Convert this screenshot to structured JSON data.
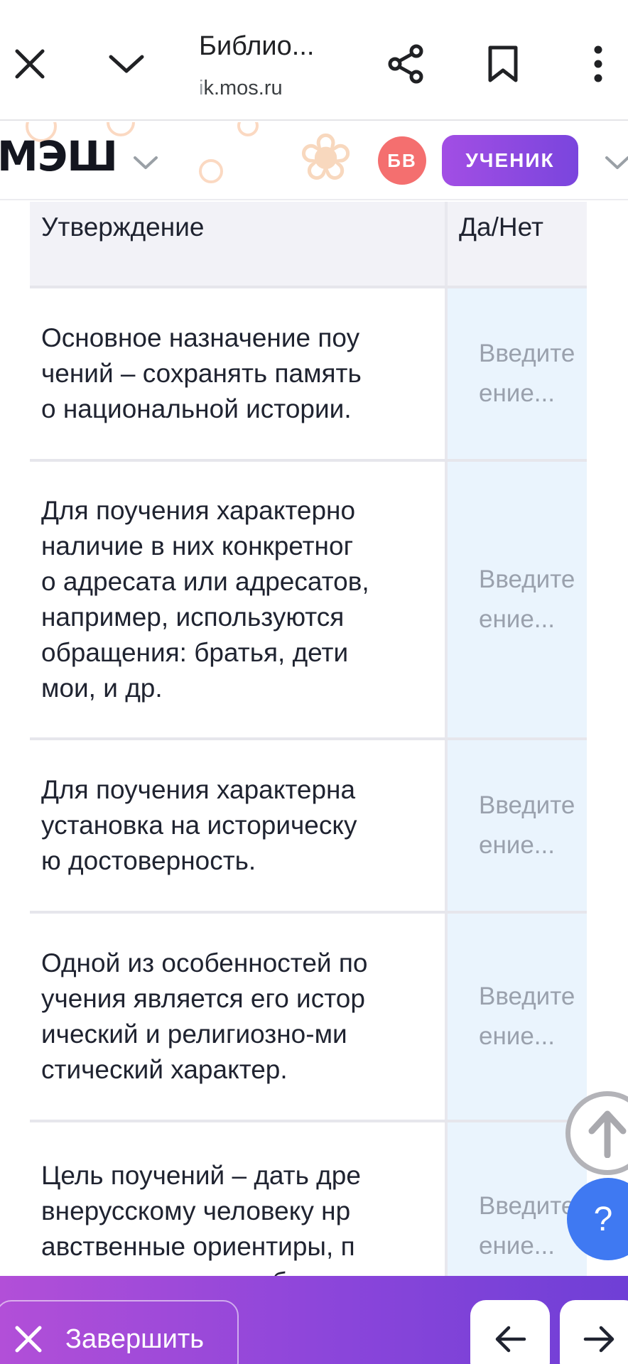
{
  "browser": {
    "title": "Библио...",
    "url_dim": "i",
    "url_main": "k.mos.ru"
  },
  "header": {
    "logo": "МЭШ",
    "avatar_initials": "БВ",
    "role_button": "УЧЕНИК",
    "colors": {
      "avatar": "#f46f6f",
      "role_button": "#8e4ae0"
    }
  },
  "table": {
    "headers": [
      "Утверждение",
      "Да/Нет"
    ],
    "rows": [
      {
        "statement": "Основное назначение поу\nчений – сохранять память\nо национальной истории.",
        "placeholder": "Введите\nение..."
      },
      {
        "statement": "Для поучения характерно\nналичие в них конкретног\nо адресата или адресатов,\nнапример, используются\nобращения: братья, дети\nмои, и др.",
        "placeholder": "Введите\nение..."
      },
      {
        "statement": "Для поучения характерна\nустановка на историческу\nю достоверность.",
        "placeholder": "Введите\nение..."
      },
      {
        "statement": "Одной из особенностей по\nучения является его истор\nический и религиозно-ми\nстический характер.",
        "placeholder": "Введите\nение..."
      },
      {
        "statement": "Цель поучений – дать дре\nвнерусскому человеку нр\nавственные ориентиры, п\nоказать примеры убедит",
        "placeholder": "Введите\nение..."
      }
    ]
  },
  "help_fab": "?",
  "bottom": {
    "finish_label": "Завершить",
    "colors": {
      "gradient_start": "#b24fd8",
      "gradient_end": "#6f3fd6"
    }
  }
}
